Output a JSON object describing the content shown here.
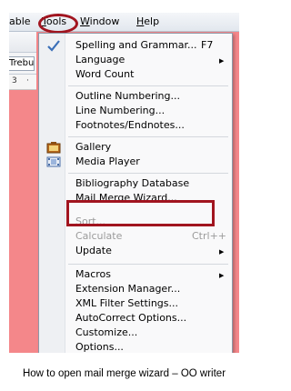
{
  "menubar": {
    "table_fragment": "able",
    "tools": "Tools",
    "window": "Window",
    "help": "Help"
  },
  "toolbar": {
    "font_name": "Trebuc"
  },
  "ruler": {
    "marks": [
      "3",
      "·"
    ]
  },
  "tools_menu": {
    "items": [
      {
        "label": "Spelling and Grammar...",
        "shortcut": "F7",
        "enabled": true,
        "icon": "spellcheck-icon"
      },
      {
        "label": "Language",
        "enabled": true,
        "submenu": true
      },
      {
        "label": "Word Count",
        "enabled": true
      },
      {
        "label": "Outline Numbering...",
        "enabled": true
      },
      {
        "label": "Line Numbering...",
        "enabled": true
      },
      {
        "label": "Footnotes/Endnotes...",
        "enabled": true
      },
      {
        "label": "Gallery",
        "enabled": true,
        "icon": "gallery-icon"
      },
      {
        "label": "Media Player",
        "enabled": true,
        "icon": "media-player-icon"
      },
      {
        "label": "Bibliography Database",
        "enabled": true
      },
      {
        "label": "Mail Merge Wizard...",
        "enabled": true,
        "highlighted": true
      },
      {
        "label": "Sort...",
        "enabled": false
      },
      {
        "label": "Calculate",
        "shortcut": "Ctrl++",
        "enabled": false
      },
      {
        "label": "Update",
        "enabled": true,
        "submenu": true
      },
      {
        "label": "Macros",
        "enabled": true,
        "submenu": true
      },
      {
        "label": "Extension Manager...",
        "enabled": true
      },
      {
        "label": "XML Filter Settings...",
        "enabled": true
      },
      {
        "label": "AutoCorrect Options...",
        "enabled": true
      },
      {
        "label": "Customize...",
        "enabled": true
      },
      {
        "label": "Options...",
        "enabled": true
      }
    ]
  },
  "colors": {
    "highlight_outline": "#a1141f",
    "document_background": "#f4878a"
  },
  "caption": "How to open mail merge wizard – OO writer"
}
